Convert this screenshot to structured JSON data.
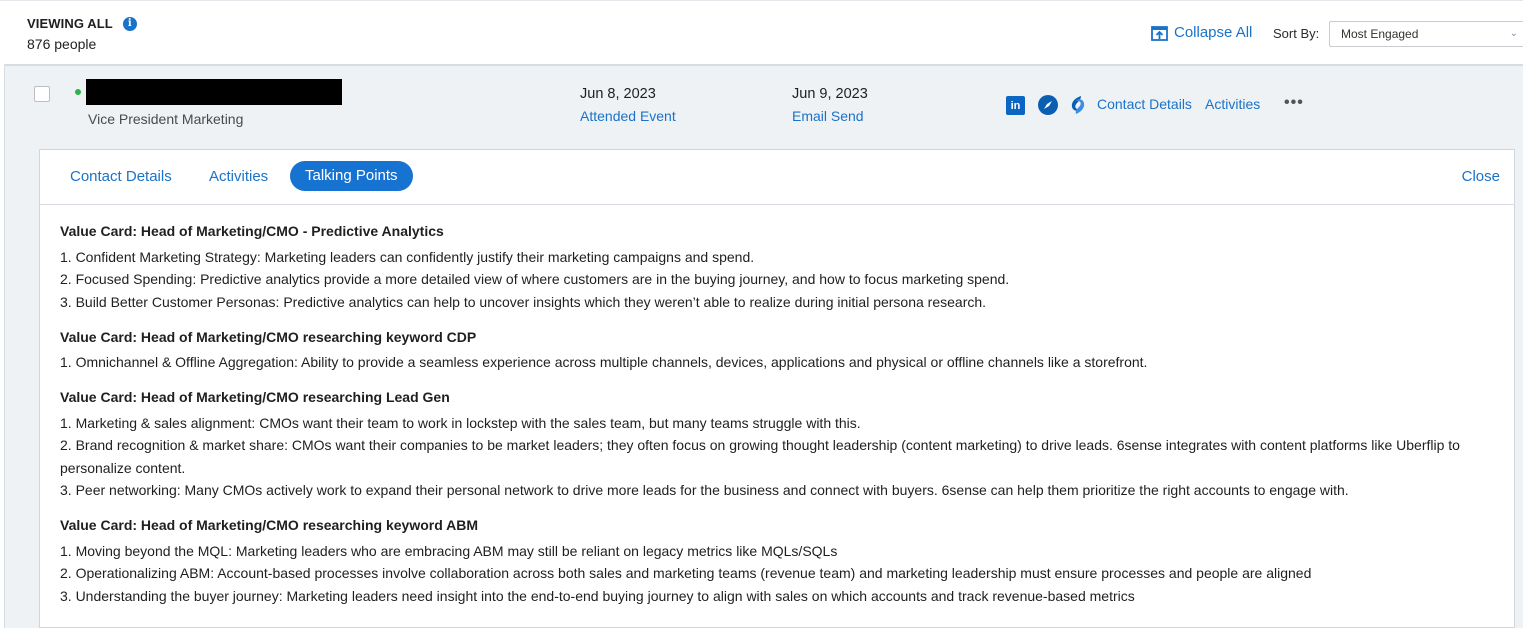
{
  "header": {
    "viewing_label": "VIEWING ALL",
    "info_icon": "info-icon",
    "people_count": "876 people",
    "collapse_all": "Collapse All",
    "sort_label": "Sort By:",
    "sort_value": "Most Engaged"
  },
  "person": {
    "title": "Vice President Marketing",
    "status_color": "#2fb24a",
    "activity1": {
      "date": "Jun 8, 2023",
      "label": "Attended Event"
    },
    "activity2": {
      "date": "Jun 9, 2023",
      "label": "Email Send"
    },
    "linkedin_text": "in",
    "contact_details_link": "Contact Details",
    "activities_link": "Activities",
    "more_label": "•••"
  },
  "card": {
    "tabs": {
      "contact_details": "Contact Details",
      "activities": "Activities",
      "talking_points": "Talking Points"
    },
    "close": "Close",
    "sections": [
      {
        "title": "Value Card: Head of Marketing/CMO - Predictive Analytics",
        "points": [
          "1. Confident Marketing Strategy: Marketing leaders can confidently justify their marketing campaigns and spend.",
          "2. Focused Spending: Predictive analytics provide a more detailed view of where customers are in the buying journey, and how to focus marketing spend.",
          "3. Build Better Customer Personas: Predictive analytics can help to uncover insights which they weren’t able to realize during initial persona research."
        ]
      },
      {
        "title": "Value Card: Head of Marketing/CMO researching keyword CDP",
        "points": [
          "1. Omnichannel & Offline Aggregation: Ability to provide a seamless experience across multiple channels, devices, applications and physical or offline channels like a storefront."
        ]
      },
      {
        "title": "Value Card: Head of Marketing/CMO researching Lead Gen",
        "points": [
          "1. Marketing & sales alignment: CMOs want their team to work in lockstep with the sales team, but many teams struggle with this.",
          "2. Brand recognition & market share: CMOs want their companies to be market leaders; they often focus on growing thought leadership (content marketing) to drive leads. 6sense integrates with content platforms like Uberflip to personalize content.",
          "3. Peer networking: Many CMOs actively work to expand their personal network to drive more leads for the business and connect with buyers. 6sense can help them prioritize the right accounts to engage with."
        ]
      },
      {
        "title": "Value Card: Head of Marketing/CMO researching keyword ABM",
        "points": [
          "1. Moving beyond the MQL: Marketing leaders who are embracing ABM may still be reliant on legacy metrics like MQLs/SQLs",
          "2. Operationalizing ABM: Account-based processes involve collaboration across both sales and marketing teams (revenue team) and marketing leadership must ensure processes and people are aligned",
          "3. Understanding the buyer journey:  Marketing leaders need insight into the end-to-end buying journey to align with sales on which accounts and track revenue-based metrics"
        ]
      }
    ]
  }
}
